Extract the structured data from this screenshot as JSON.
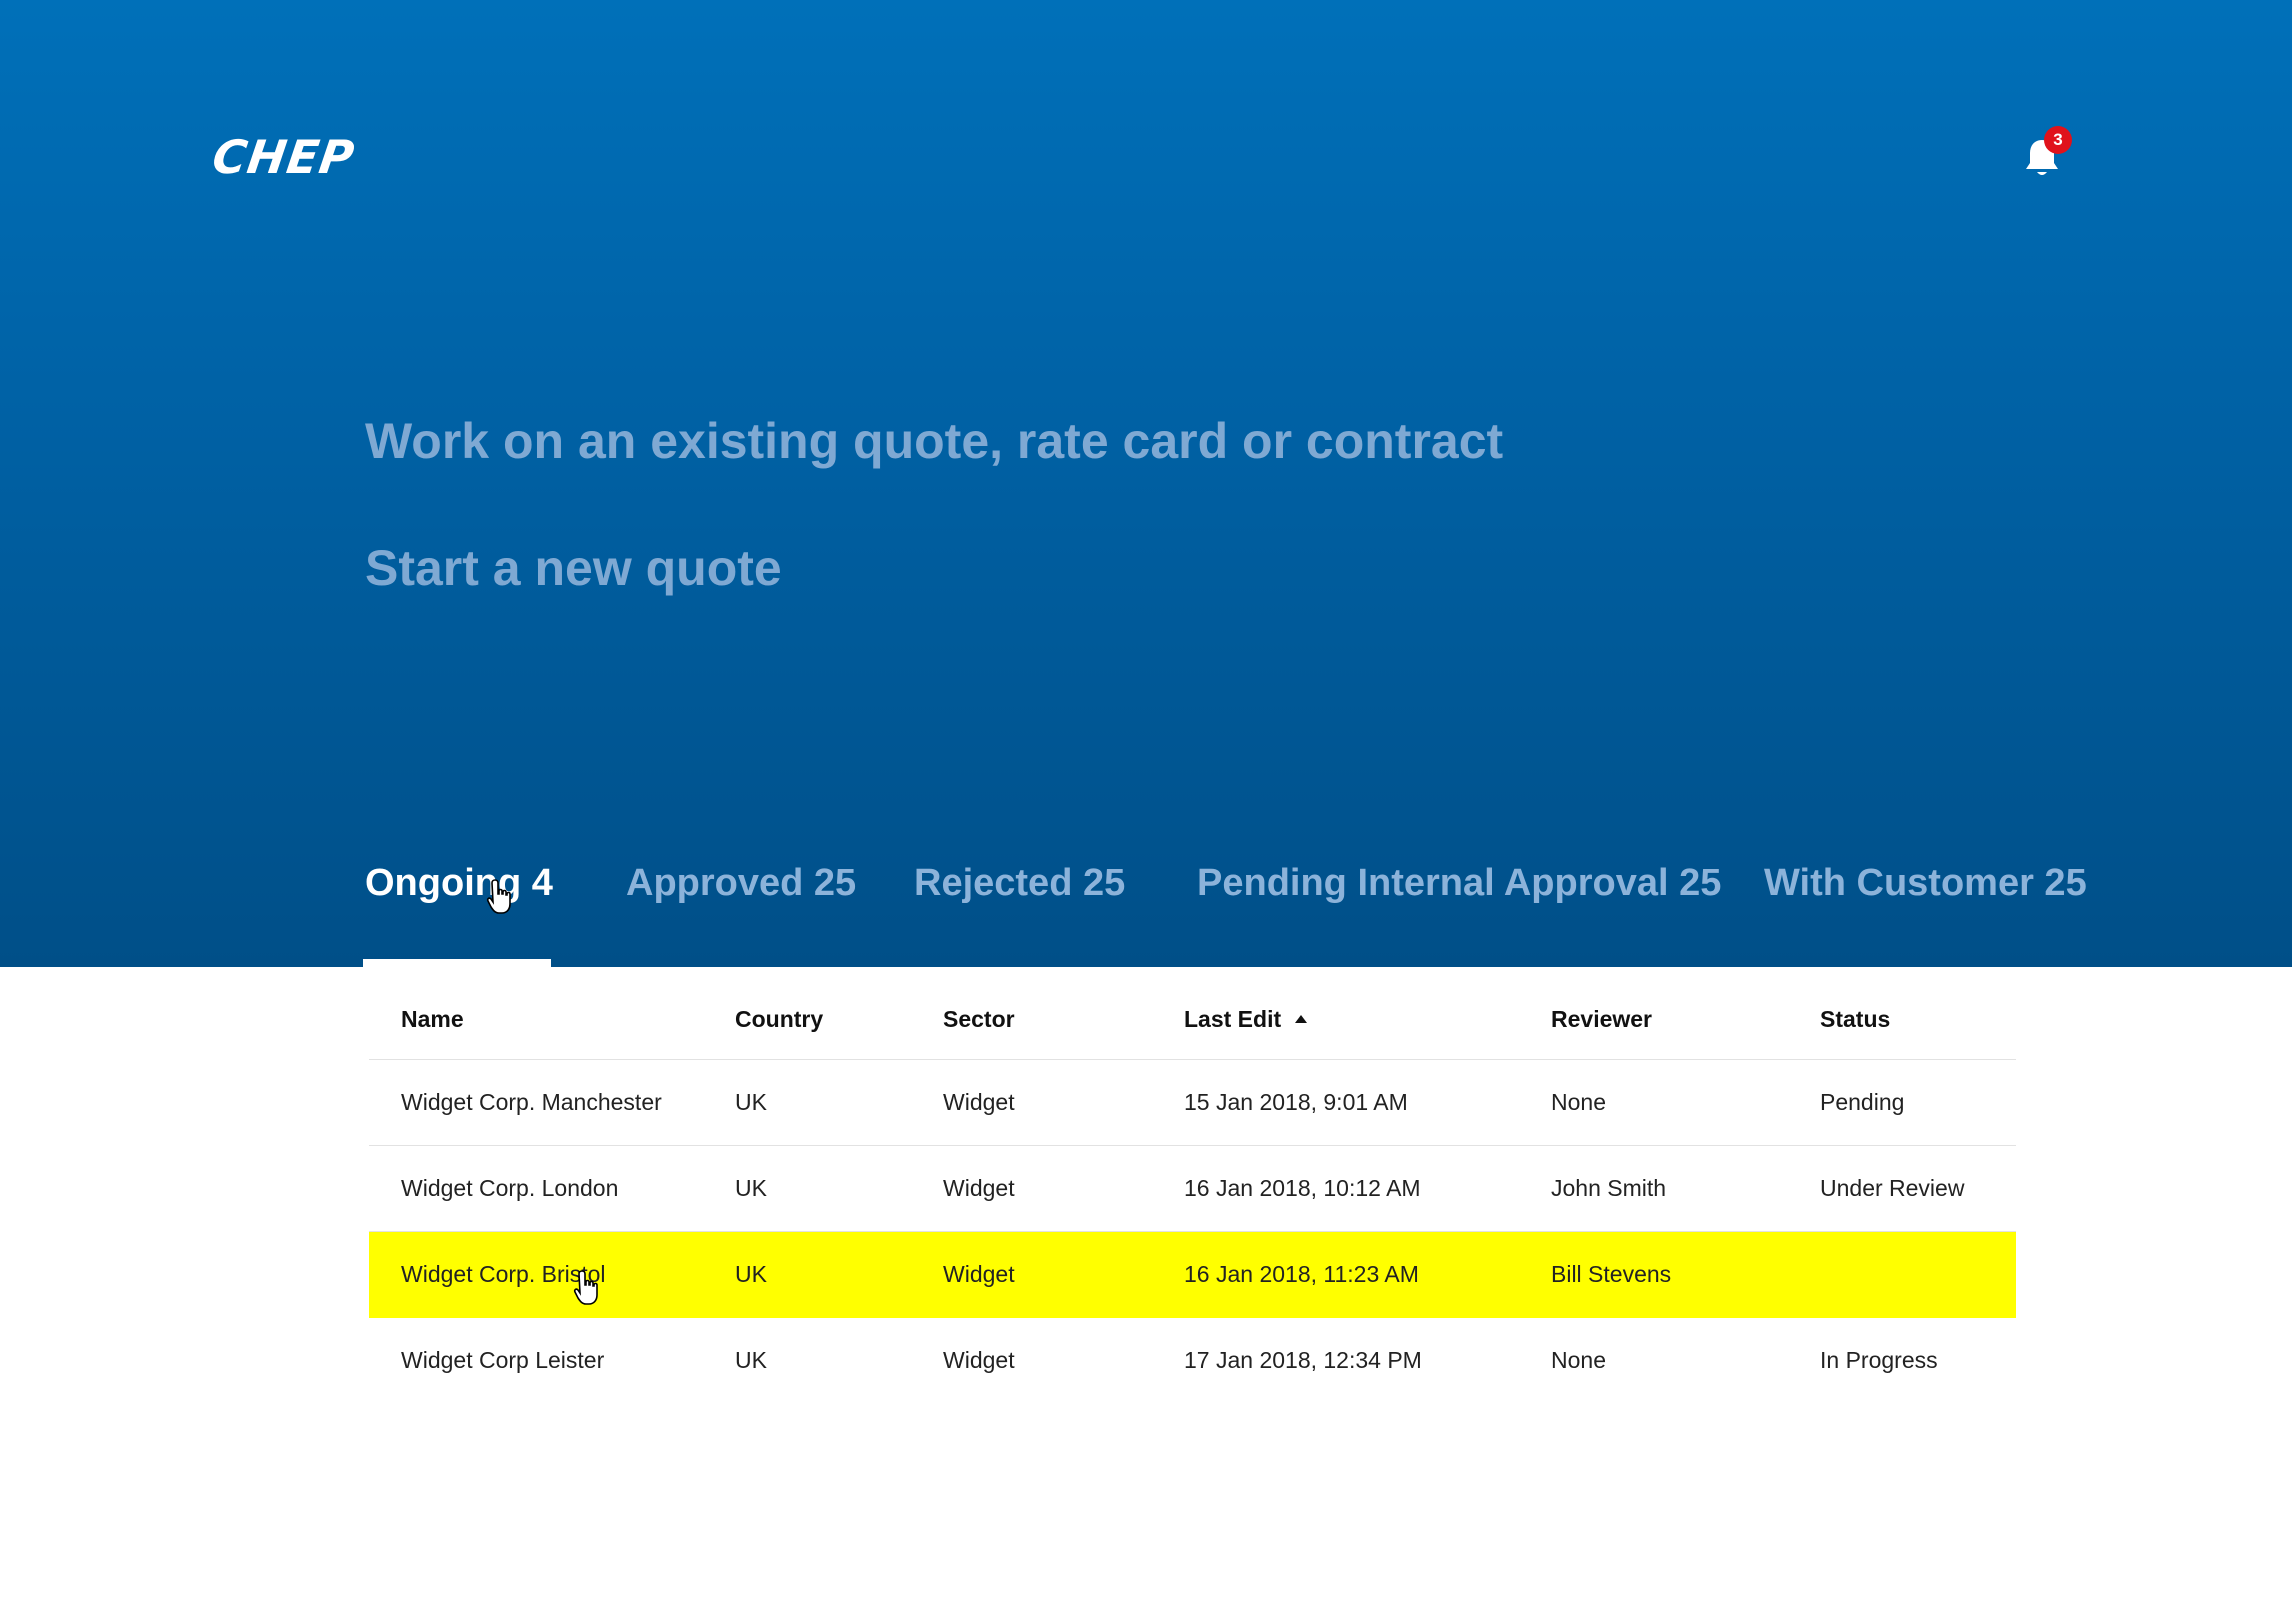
{
  "header": {
    "logo_text": "CHEP",
    "notification_count": "3"
  },
  "actions": {
    "existing": "Work on an existing quote, rate card or contract",
    "new_quote": "Start a new quote"
  },
  "tabs": [
    {
      "label": "Ongoing 4",
      "active": true
    },
    {
      "label": "Approved 25",
      "active": false
    },
    {
      "label": "Rejected 25",
      "active": false
    },
    {
      "label": "Pending Internal Approval 25",
      "active": false
    },
    {
      "label": "With Customer 25",
      "active": false
    }
  ],
  "table": {
    "columns": [
      "Name",
      "Country",
      "Sector",
      "Last Edit",
      "Reviewer",
      "Status"
    ],
    "sort": {
      "column": "Last Edit",
      "direction": "ascending"
    },
    "rows": [
      {
        "name": "Widget Corp. Manchester",
        "country": "UK",
        "sector": "Widget",
        "last_edit": "15 Jan 2018, 9:01 AM",
        "reviewer": "None",
        "status": "Pending"
      },
      {
        "name": "Widget Corp. London",
        "country": "UK",
        "sector": "Widget",
        "last_edit": "16 Jan 2018, 10:12 AM",
        "reviewer": "John Smith",
        "status": "Under Review"
      },
      {
        "name": "Widget Corp. Bristol",
        "country": "UK",
        "sector": "Widget",
        "last_edit": "16 Jan 2018, 11:23 AM",
        "reviewer": "Bill Stevens",
        "status": ""
      },
      {
        "name": "Widget Corp Leister",
        "country": "UK",
        "sector": "Widget",
        "last_edit": "17 Jan 2018, 12:34 PM",
        "reviewer": "None",
        "status": "In Progress"
      }
    ]
  },
  "colors": {
    "hero_top": "#0070b9",
    "hero_bottom": "#004f88",
    "highlight_row": "#ffff00",
    "badge": "#e0121b"
  }
}
